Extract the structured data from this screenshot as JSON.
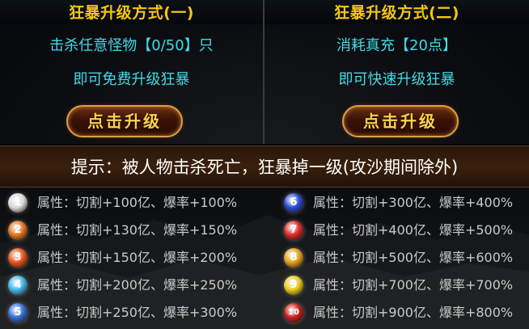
{
  "panels": [
    {
      "title": "狂暴升级方式(一)",
      "condition": "击杀任意怪物【0/50】只",
      "result": "即可免费升级狂暴",
      "button": "点击升级"
    },
    {
      "title": "狂暴升级方式(二)",
      "condition": "消耗真充【20点】",
      "result": "即可快速升级狂暴",
      "button": "点击升级"
    }
  ],
  "hint": "提示：被人物击杀死亡，狂暴掉一级(攻沙期间除外)",
  "levels": [
    {
      "badge": "1",
      "badge_color": "#d9d9d9",
      "text": "属性：切割+100亿、爆率+100%"
    },
    {
      "badge": "2",
      "badge_color": "#e0731f",
      "text": "属性：切割+130亿、爆率+150%"
    },
    {
      "badge": "3",
      "badge_color": "#e8541a",
      "text": "属性：切割+150亿、爆率+200%"
    },
    {
      "badge": "4",
      "badge_color": "#3fb6e8",
      "text": "属性：切割+200亿、爆率+250%"
    },
    {
      "badge": "5",
      "badge_color": "#2f6fd6",
      "text": "属性：切割+250亿、爆率+300%"
    },
    {
      "badge": "6",
      "badge_color": "#2a49d8",
      "text": "属性：切割+300亿、爆率+400%"
    },
    {
      "badge": "7",
      "badge_color": "#d92a2a",
      "text": "属性：切割+400亿、爆率+500%"
    },
    {
      "badge": "8",
      "badge_color": "#e0a11c",
      "text": "属性：切割+500亿、爆率+600%"
    },
    {
      "badge": "9",
      "badge_color": "#e8c81f",
      "text": "属性：切割+700亿、爆率+700%"
    },
    {
      "badge": "10",
      "badge_color": "#c81e1e",
      "text": "属性：切割+900亿、爆率+800%"
    }
  ]
}
